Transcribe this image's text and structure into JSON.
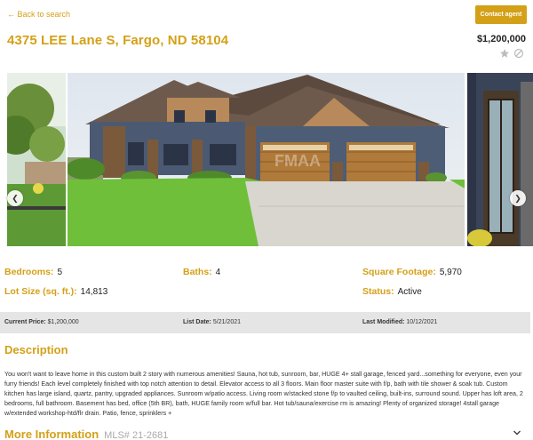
{
  "header": {
    "back_label": "← Back to search",
    "contact_label": "Contact agent",
    "address": "4375 LEE Lane S, Fargo, ND 58104",
    "price": "$1,200,000"
  },
  "icons": {
    "favorite": "star-icon",
    "hide": "ban-icon",
    "prev": "chevron-left-icon",
    "next": "chevron-right-icon",
    "expand": "chevron-down-icon"
  },
  "gallery": {
    "watermark": "FMAA"
  },
  "facts": {
    "bedrooms": {
      "label": "Bedrooms:",
      "value": "5"
    },
    "baths": {
      "label": "Baths:",
      "value": "4"
    },
    "sqft": {
      "label": "Square Footage:",
      "value": "5,970"
    },
    "lot": {
      "label": "Lot Size (sq. ft.):",
      "value": "14,813"
    },
    "status": {
      "label": "Status:",
      "value": "Active"
    }
  },
  "summary": {
    "current_price": {
      "label": "Current Price:",
      "value": "$1,200,000"
    },
    "list_date": {
      "label": "List Date:",
      "value": "5/21/2021"
    },
    "last_modified": {
      "label": "Last Modified:",
      "value": "10/12/2021"
    }
  },
  "description": {
    "title": "Description",
    "text": "You won't want to leave home in this custom built 2 story with numerous amenities! Sauna, hot tub, sunroom, bar, HUGE 4+ stall garage, fenced yard...something for everyone, even your furry friends! Each level completely finished with top notch attention to detail. Elevator access to all 3 floors. Main floor master suite with f/p, bath with tile shower & soak tub. Custom kitchen has large island, quartz, pantry, upgraded appliances. Sunroom w/patio access. Living room w/stacked stone f/p to vaulted ceiling, built-ins, surround sound. Upper has loft area, 2 bedrooms, full bathroom. Basement has bed, office (5th BR), bath, HUGE family room w/full bar. Hot tub/sauna/exercise rm is amazing! Plenty of organized storage! 4stall garage w/extended workshop-htd/flr drain. Patio, fence, sprinklers +"
  },
  "more_info": {
    "title": "More Information",
    "mls": "MLS# 21-2681"
  }
}
